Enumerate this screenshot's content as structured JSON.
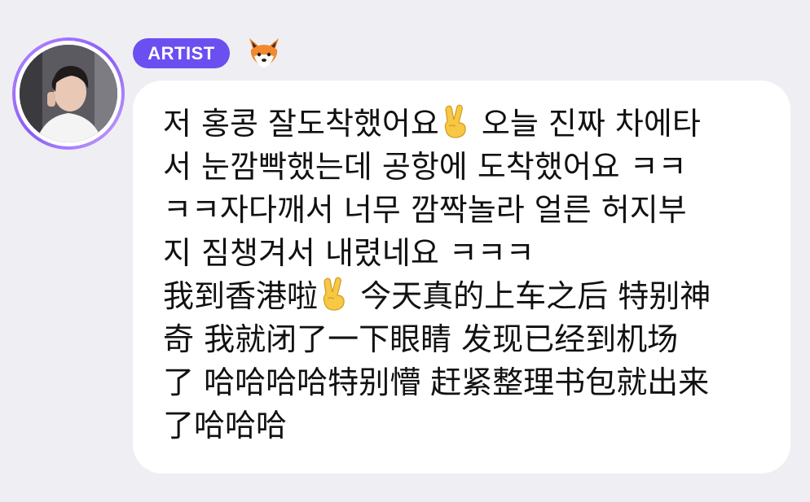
{
  "post": {
    "author_badge": "ARTIST",
    "author_emoji_icon": "fox-face-icon",
    "avatar_icon": "profile-avatar",
    "message_lines_ko": [
      "저 홍콩 잘도착했어요",
      "오늘 진짜 차에타",
      "서 눈깜빡했는데 공항에 도착했어요 ㅋㅋ",
      "ㅋㅋ자다깨서 너무 깜짝놀라 얼른 허지부",
      "지 짐챙겨서 내렸네요 ㅋㅋㅋ"
    ],
    "message_lines_zh": [
      "我到香港啦",
      "今天真的上车之后 特别神",
      "奇 我就闭了一下眼睛 发现已经到机场",
      "了 哈哈哈哈特别懵 赶紧整理书包就出来",
      "了哈哈哈"
    ],
    "emoji_inline_icon": "victory-hand-icon"
  },
  "colors": {
    "background": "#efeff3",
    "bubble": "#ffffff",
    "badge": "#6b4ff0",
    "avatar_ring": "#9b6bff",
    "text": "#111111"
  }
}
